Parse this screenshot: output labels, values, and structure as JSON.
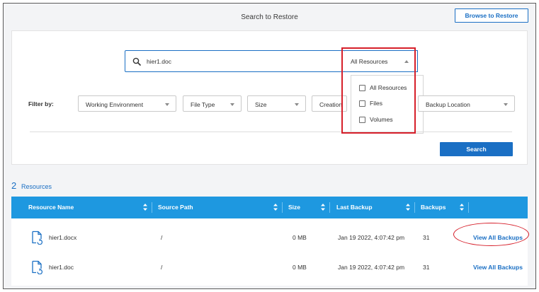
{
  "header": {
    "title": "Search to Restore",
    "browse_button": "Browse to Restore"
  },
  "search": {
    "query": "hier1.doc",
    "scope_selected": "All Resources",
    "scope_options": [
      "All Resources",
      "Files",
      "Volumes"
    ]
  },
  "filters": {
    "label": "Filter by:",
    "selects": [
      "Working Environment",
      "File Type",
      "Size",
      "Creation",
      "Backup Location"
    ]
  },
  "search_button": "Search",
  "results": {
    "count": "2",
    "label": "Resources"
  },
  "table": {
    "columns": [
      "Resource Name",
      "Source Path",
      "Size",
      "Last Backup",
      "Backups"
    ],
    "rows": [
      {
        "name": "hier1.docx",
        "path": "/",
        "size": "0 MB",
        "last_backup": "Jan 19 2022, 4:07:42 pm",
        "backups": "31",
        "action": "View All Backups"
      },
      {
        "name": "hier1.doc",
        "path": "/",
        "size": "0 MB",
        "last_backup": "Jan 19 2022, 4:07:42 pm",
        "backups": "31",
        "action": "View All Backups"
      }
    ]
  },
  "colors": {
    "accent": "#1a6fc4",
    "table_header": "#1e98e0",
    "annotation": "#d61f2a"
  },
  "icons": [
    "search-icon",
    "chevron-up-icon",
    "chevron-down-icon",
    "sort-icon",
    "file-icon"
  ]
}
